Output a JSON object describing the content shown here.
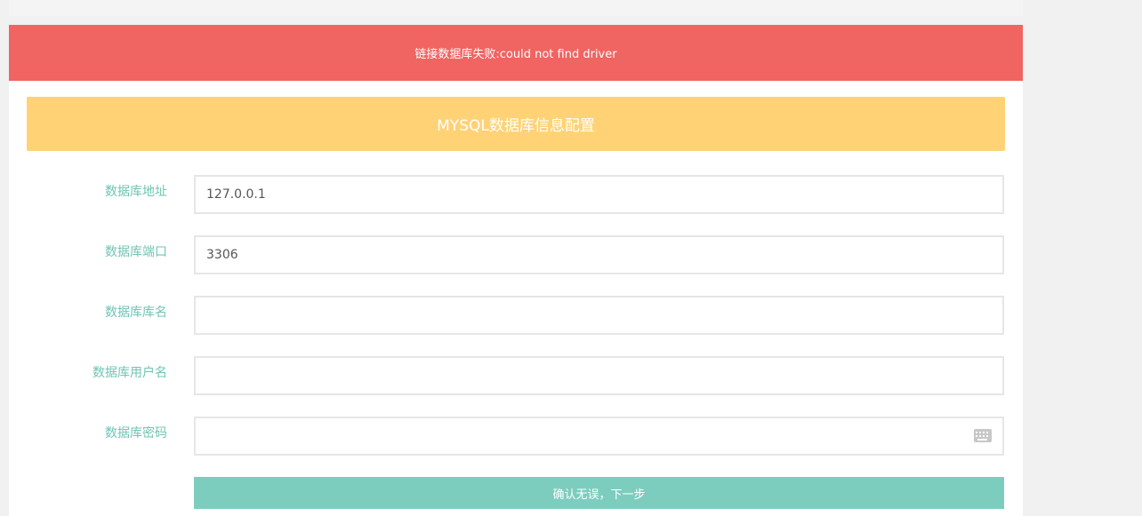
{
  "alert": {
    "message": "链接数据库失败:could not find driver",
    "color": "#f06461"
  },
  "form": {
    "title": "MYSQL数据库信息配置",
    "header_color": "#ffd275",
    "fields": [
      {
        "label": "数据库地址",
        "value": "127.0.0.1"
      },
      {
        "label": "数据库端口",
        "value": "3306"
      },
      {
        "label": "数据库库名",
        "value": ""
      },
      {
        "label": "数据库用户名",
        "value": ""
      },
      {
        "label": "数据库密码",
        "value": "",
        "icon": "keyboard-icon"
      }
    ],
    "submit_label": "确认无误，下一步",
    "accent_color": "#7dcdbf"
  }
}
